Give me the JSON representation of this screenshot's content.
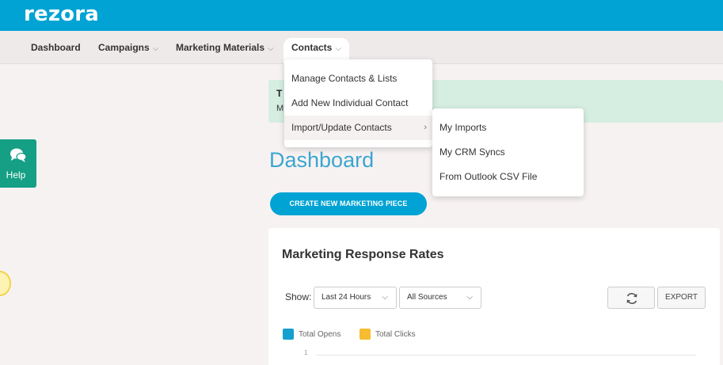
{
  "app": {
    "logo": "rezora",
    "brand_color": "#00a3d3"
  },
  "nav": {
    "items": [
      {
        "label": "Dashboard",
        "has_menu": false
      },
      {
        "label": "Campaigns",
        "has_menu": true
      },
      {
        "label": "Marketing Materials",
        "has_menu": true
      },
      {
        "label": "Contacts",
        "has_menu": true,
        "active": true
      }
    ]
  },
  "contacts_menu": {
    "items": [
      {
        "label": "Manage Contacts & Lists"
      },
      {
        "label": "Add New Individual Contact"
      },
      {
        "label": "Import/Update Contacts",
        "has_submenu": true
      }
    ]
  },
  "import_submenu": {
    "items": [
      {
        "label": "My Imports"
      },
      {
        "label": "My CRM Syncs"
      },
      {
        "label": "From Outlook CSV File"
      }
    ]
  },
  "banner": {
    "title": "T",
    "text": "M"
  },
  "help": {
    "label": "Help",
    "icon": "chat-bubbles-icon",
    "color": "#159f85"
  },
  "main": {
    "page_title": "Dashboard",
    "create_button": "CREATE NEW MARKETING PIECE"
  },
  "response_card": {
    "title": "Marketing Response Rates",
    "show_label": "Show:",
    "time_filter": "Last 24 Hours",
    "source_filter": "All Sources",
    "refresh_icon": "refresh-icon",
    "export_label": "EXPORT",
    "legend": [
      {
        "label": "Total Opens",
        "color": "#159fce"
      },
      {
        "label": "Total Clicks",
        "color": "#f5bd2f"
      }
    ],
    "axis_tick": "1"
  }
}
